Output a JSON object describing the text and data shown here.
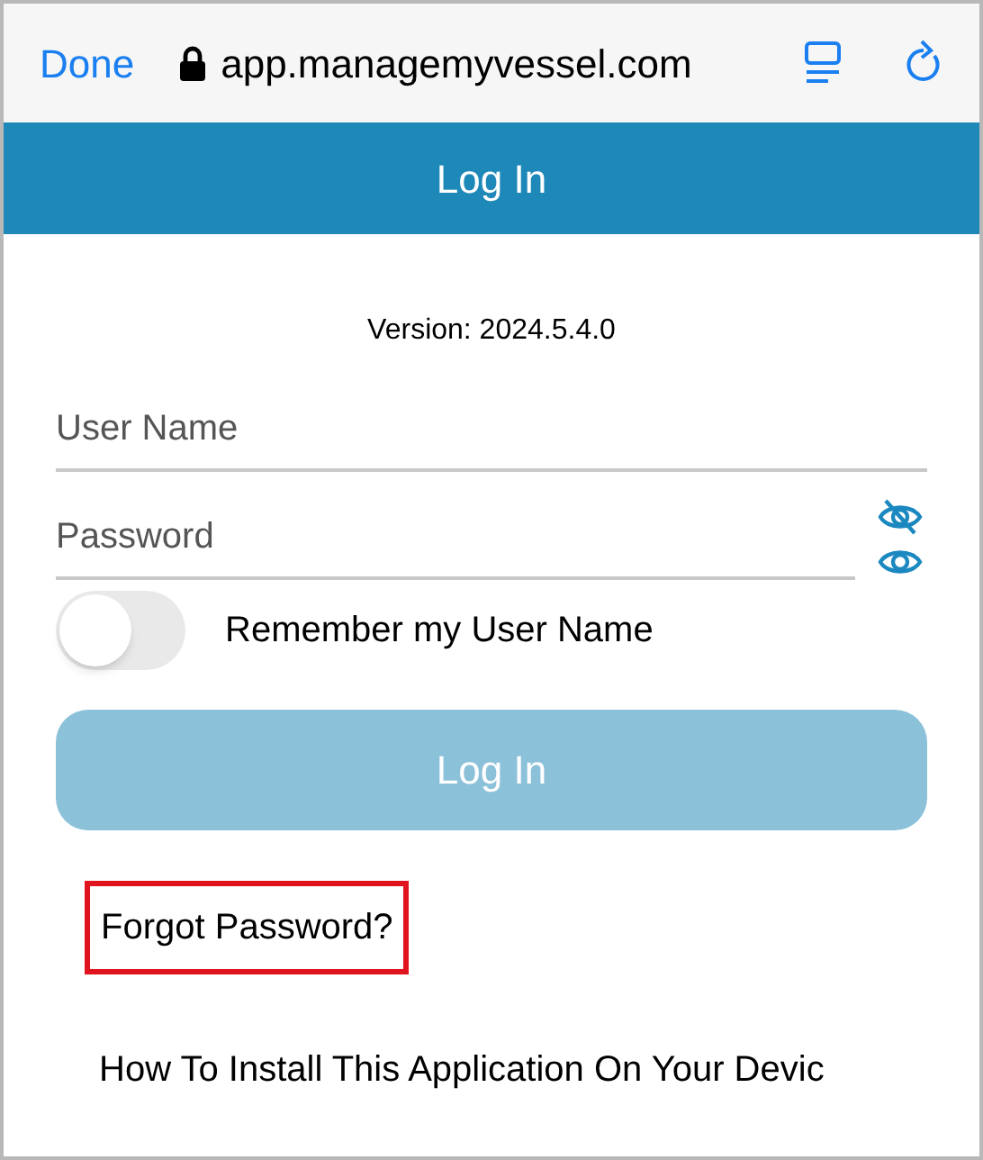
{
  "browser_bar": {
    "done": "Done",
    "url": "app.managemyvessel.com"
  },
  "header": {
    "title": "Log In"
  },
  "version": "Version: 2024.5.4.0",
  "fields": [
    {
      "placeholder": "User Name",
      "kind": "text"
    },
    {
      "placeholder": "Password",
      "kind": "password"
    }
  ],
  "remember": {
    "label": "Remember my User Name",
    "on": false
  },
  "login_button": {
    "label": "Log In",
    "disabled": true
  },
  "forgot_link": {
    "label": "Forgot Password?",
    "highlighted": true
  },
  "install_link": "How To Install This Application On Your Devic"
}
